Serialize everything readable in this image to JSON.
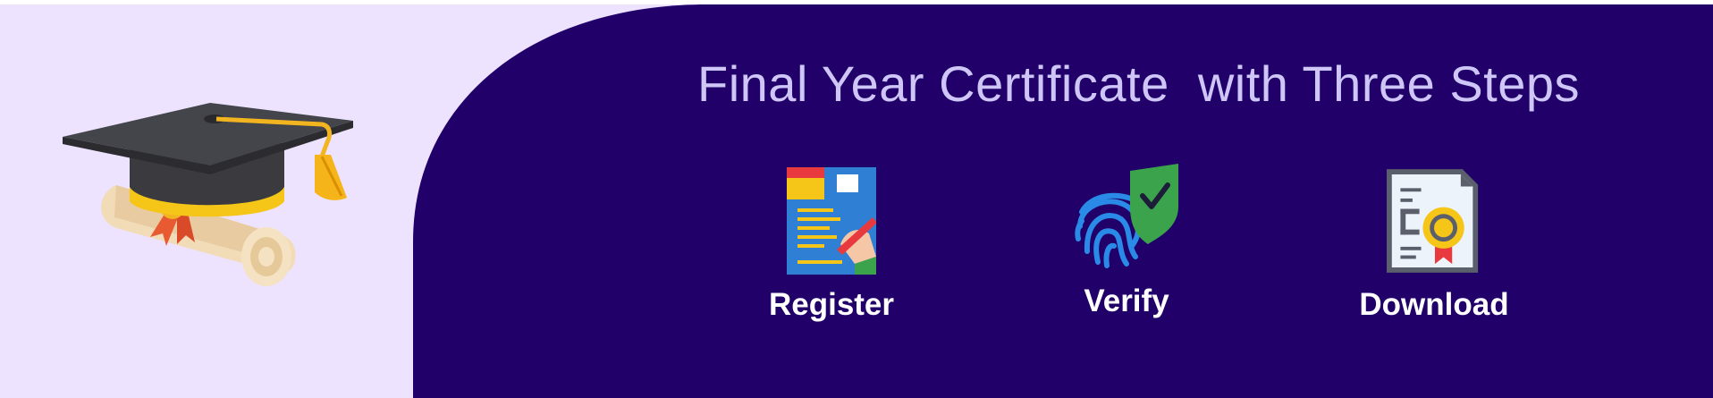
{
  "banner": {
    "title": "Final Year Certificate  with Three Steps",
    "colors": {
      "panel": "#210069",
      "background": "#ede3ff",
      "title": "#cfc6f8",
      "label": "#ffffff"
    },
    "hero_icon": "graduation-cap-with-diploma-icon",
    "steps": [
      {
        "label": "Register",
        "icon": "register-form-icon"
      },
      {
        "label": "Verify",
        "icon": "fingerprint-shield-icon"
      },
      {
        "label": "Download",
        "icon": "certificate-document-icon"
      }
    ]
  }
}
